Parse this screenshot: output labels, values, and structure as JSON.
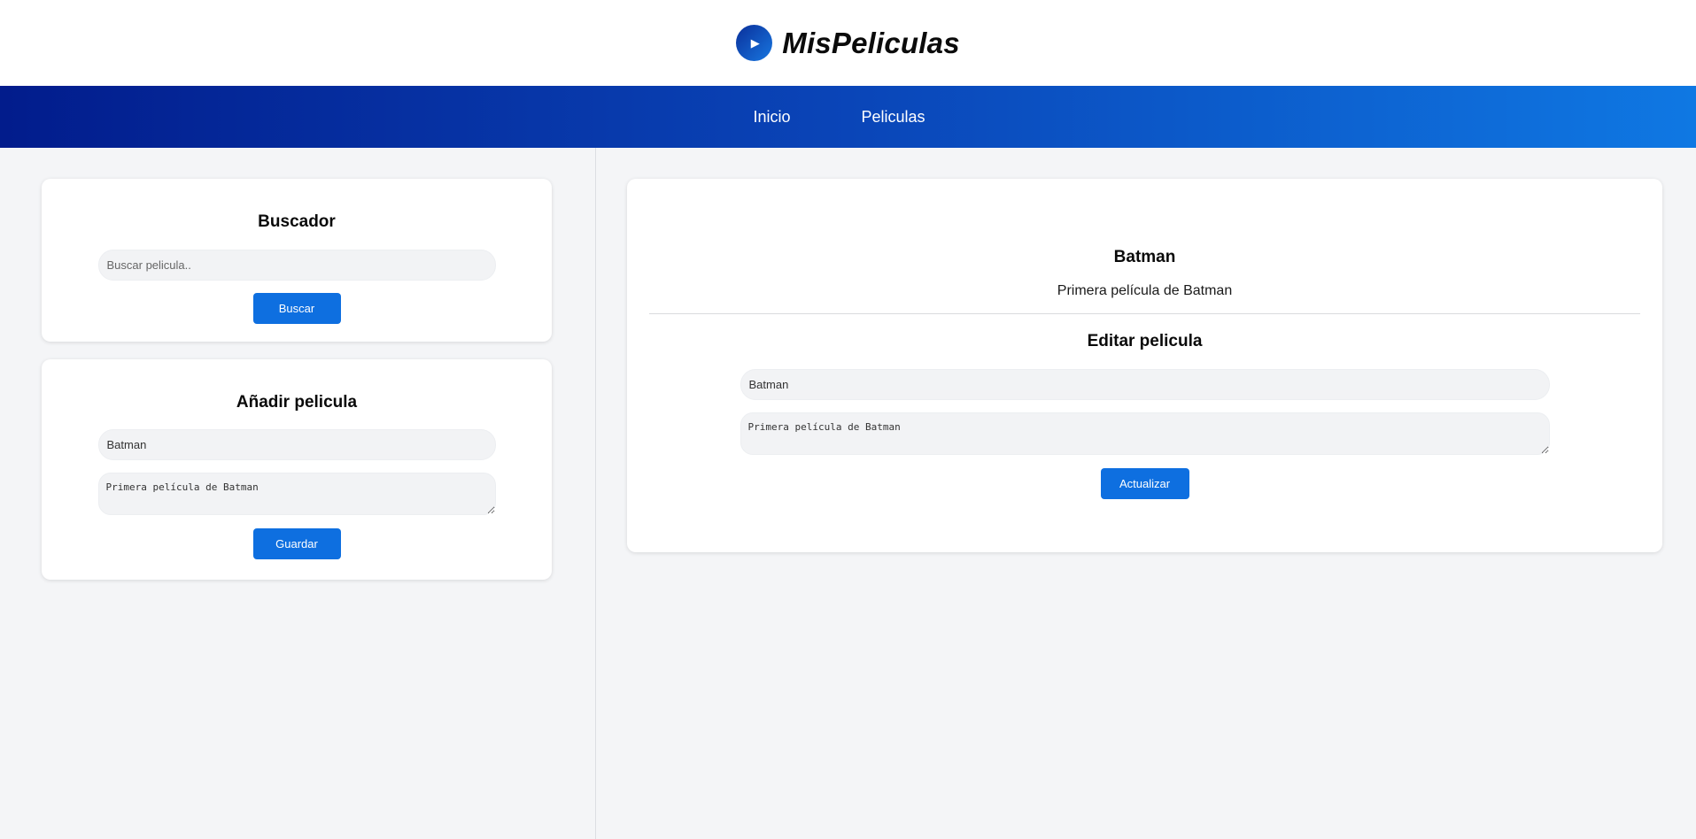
{
  "header": {
    "logo_icon": "play-icon",
    "logo_glyph": "▶",
    "title": "MisPeliculas"
  },
  "nav": {
    "items": [
      {
        "label": "Inicio"
      },
      {
        "label": "Peliculas"
      }
    ]
  },
  "search": {
    "title": "Buscador",
    "placeholder": "Buscar pelicula..",
    "value": "",
    "button": "Buscar"
  },
  "add": {
    "title": "Añadir pelicula",
    "title_value": "Batman",
    "description_value": "Primera película de Batman",
    "button": "Guardar"
  },
  "detail": {
    "title": "Batman",
    "description": "Primera película de Batman",
    "edit_title": "Editar pelicula",
    "edit_title_value": "Batman",
    "edit_description_value": "Primera película de Batman",
    "button": "Actualizar"
  },
  "colors": {
    "accent": "#0e6fe0",
    "nav_start": "#021c8c",
    "nav_end": "#0f78e3",
    "background": "#f4f5f7"
  }
}
